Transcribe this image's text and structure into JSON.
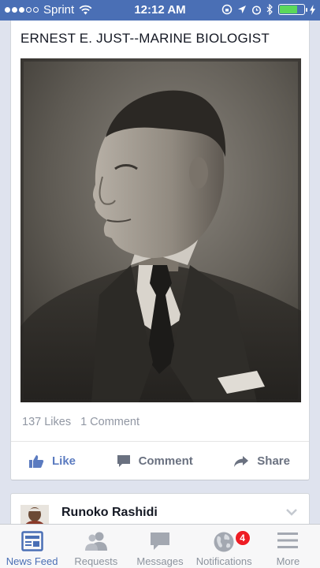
{
  "status_bar": {
    "carrier": "Sprint",
    "time": "12:12 AM",
    "battery_level": 0.75
  },
  "post": {
    "title": "ERNEST E. JUST--MARINE BIOLOGIST",
    "likes": "137 Likes",
    "comments": "1 Comment",
    "actions": {
      "like": "Like",
      "comment": "Comment",
      "share": "Share"
    }
  },
  "next_post": {
    "author": "Runoko Rashidi"
  },
  "tab_bar": {
    "tabs": [
      {
        "label": "News Feed",
        "icon": "news-feed-icon",
        "active": true
      },
      {
        "label": "Requests",
        "icon": "requests-icon"
      },
      {
        "label": "Messages",
        "icon": "messages-icon"
      },
      {
        "label": "Notifications",
        "icon": "globe-icon",
        "badge": "4"
      },
      {
        "label": "More",
        "icon": "menu-icon"
      }
    ]
  },
  "colors": {
    "facebook_blue": "#4a6fb5",
    "battery_green": "#5bd85b",
    "badge_red": "#ee1d24"
  }
}
